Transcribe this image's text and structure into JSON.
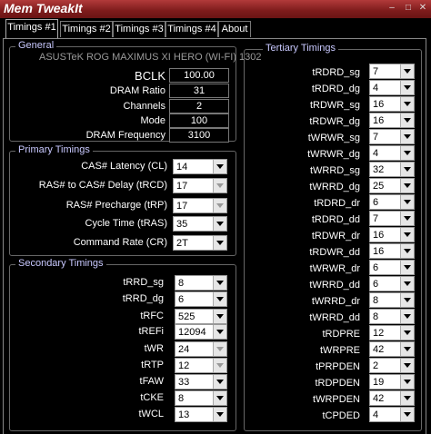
{
  "window": {
    "title": "Mem TweakIt"
  },
  "tabs": [
    "Timings #1",
    "Timings #2",
    "Timings #3",
    "Timings #4",
    "About"
  ],
  "general": {
    "label": "General",
    "board": "ASUSTeK ROG MAXIMUS XI HERO (WI-FI) 1302",
    "rows": [
      {
        "label": "BCLK",
        "value": "100.00"
      },
      {
        "label": "DRAM Ratio",
        "value": "31"
      },
      {
        "label": "Channels",
        "value": "2"
      },
      {
        "label": "Mode",
        "value": "100"
      },
      {
        "label": "DRAM Frequency",
        "value": "3100"
      }
    ]
  },
  "primary": {
    "label": "Primary Timings",
    "rows": [
      {
        "label": "CAS# Latency (CL)",
        "value": "14"
      },
      {
        "label": "RAS# to CAS# Delay (tRCD)",
        "value": "17"
      },
      {
        "label": "RAS# Precharge (tRP)",
        "value": "17"
      },
      {
        "label": "Cycle Time (tRAS)",
        "value": "35"
      },
      {
        "label": "Command Rate (CR)",
        "value": "2T"
      }
    ]
  },
  "secondary": {
    "label": "Secondary Timings",
    "rows": [
      {
        "label": "tRRD_sg",
        "value": "8"
      },
      {
        "label": "tRRD_dg",
        "value": "6"
      },
      {
        "label": "tRFC",
        "value": "525"
      },
      {
        "label": "tREFi",
        "value": "12094"
      },
      {
        "label": "tWR",
        "value": "24"
      },
      {
        "label": "tRTP",
        "value": "12"
      },
      {
        "label": "tFAW",
        "value": "33"
      },
      {
        "label": "tCKE",
        "value": "8"
      },
      {
        "label": "tWCL",
        "value": "13"
      }
    ]
  },
  "tertiary": {
    "label": "Tertiary Timings",
    "rows": [
      {
        "label": "tRDRD_sg",
        "value": "7"
      },
      {
        "label": "tRDRD_dg",
        "value": "4"
      },
      {
        "label": "tRDWR_sg",
        "value": "16"
      },
      {
        "label": "tRDWR_dg",
        "value": "16"
      },
      {
        "label": "tWRWR_sg",
        "value": "7"
      },
      {
        "label": "tWRWR_dg",
        "value": "4"
      },
      {
        "label": "tWRRD_sg",
        "value": "32"
      },
      {
        "label": "tWRRD_dg",
        "value": "25"
      },
      {
        "label": "tRDRD_dr",
        "value": "6"
      },
      {
        "label": "tRDRD_dd",
        "value": "7"
      },
      {
        "label": "tRDWR_dr",
        "value": "16"
      },
      {
        "label": "tRDWR_dd",
        "value": "16"
      },
      {
        "label": "tWRWR_dr",
        "value": "6"
      },
      {
        "label": "tWRRD_dd",
        "value": "6"
      },
      {
        "label": "tWRRD_dr",
        "value": "8"
      },
      {
        "label": "tWRRD_dd",
        "value": "8"
      },
      {
        "label": "tRDPRE",
        "value": "12"
      },
      {
        "label": "tWRPRE",
        "value": "42"
      },
      {
        "label": "tPRPDEN",
        "value": "2"
      },
      {
        "label": "tRDPDEN",
        "value": "19"
      },
      {
        "label": "tWRPDEN",
        "value": "42"
      },
      {
        "label": "tCPDED",
        "value": "4"
      }
    ]
  }
}
